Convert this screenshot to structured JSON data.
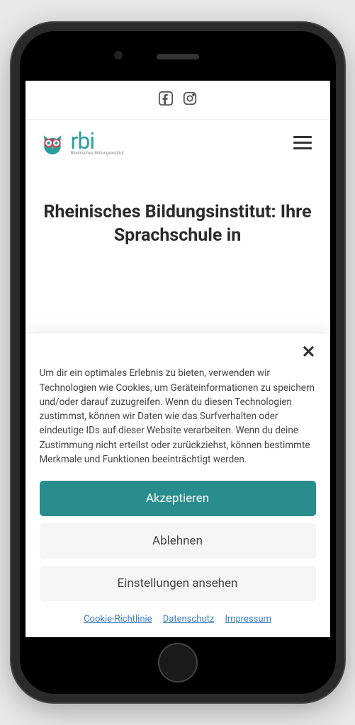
{
  "logo": {
    "text": "rbi",
    "subtitle": "Rheinisches Bildungsinstitut"
  },
  "hero": {
    "title": "Rheinisches Bildungsinstitut: Ihre Sprachschule in"
  },
  "cookie": {
    "text": "Um dir ein optimales Erlebnis zu bieten, verwenden wir Technologien wie Cookies, um Geräteinformationen zu speichern und/oder darauf zuzugreifen. Wenn du diesen Technologien zustimmst, können wir Daten wie das Surfverhalten oder eindeutige IDs auf dieser Website verarbeiten. Wenn du deine Zustimmung nicht erteilst oder zurückziehst, können bestimmte Merkmale und Funktionen beeinträchtigt werden.",
    "accept": "Akzeptieren",
    "decline": "Ablehnen",
    "settings": "Einstellungen ansehen",
    "links": {
      "policy": "Cookie-Richtlinie",
      "privacy": "Datenschutz",
      "imprint": "Impressum"
    }
  }
}
